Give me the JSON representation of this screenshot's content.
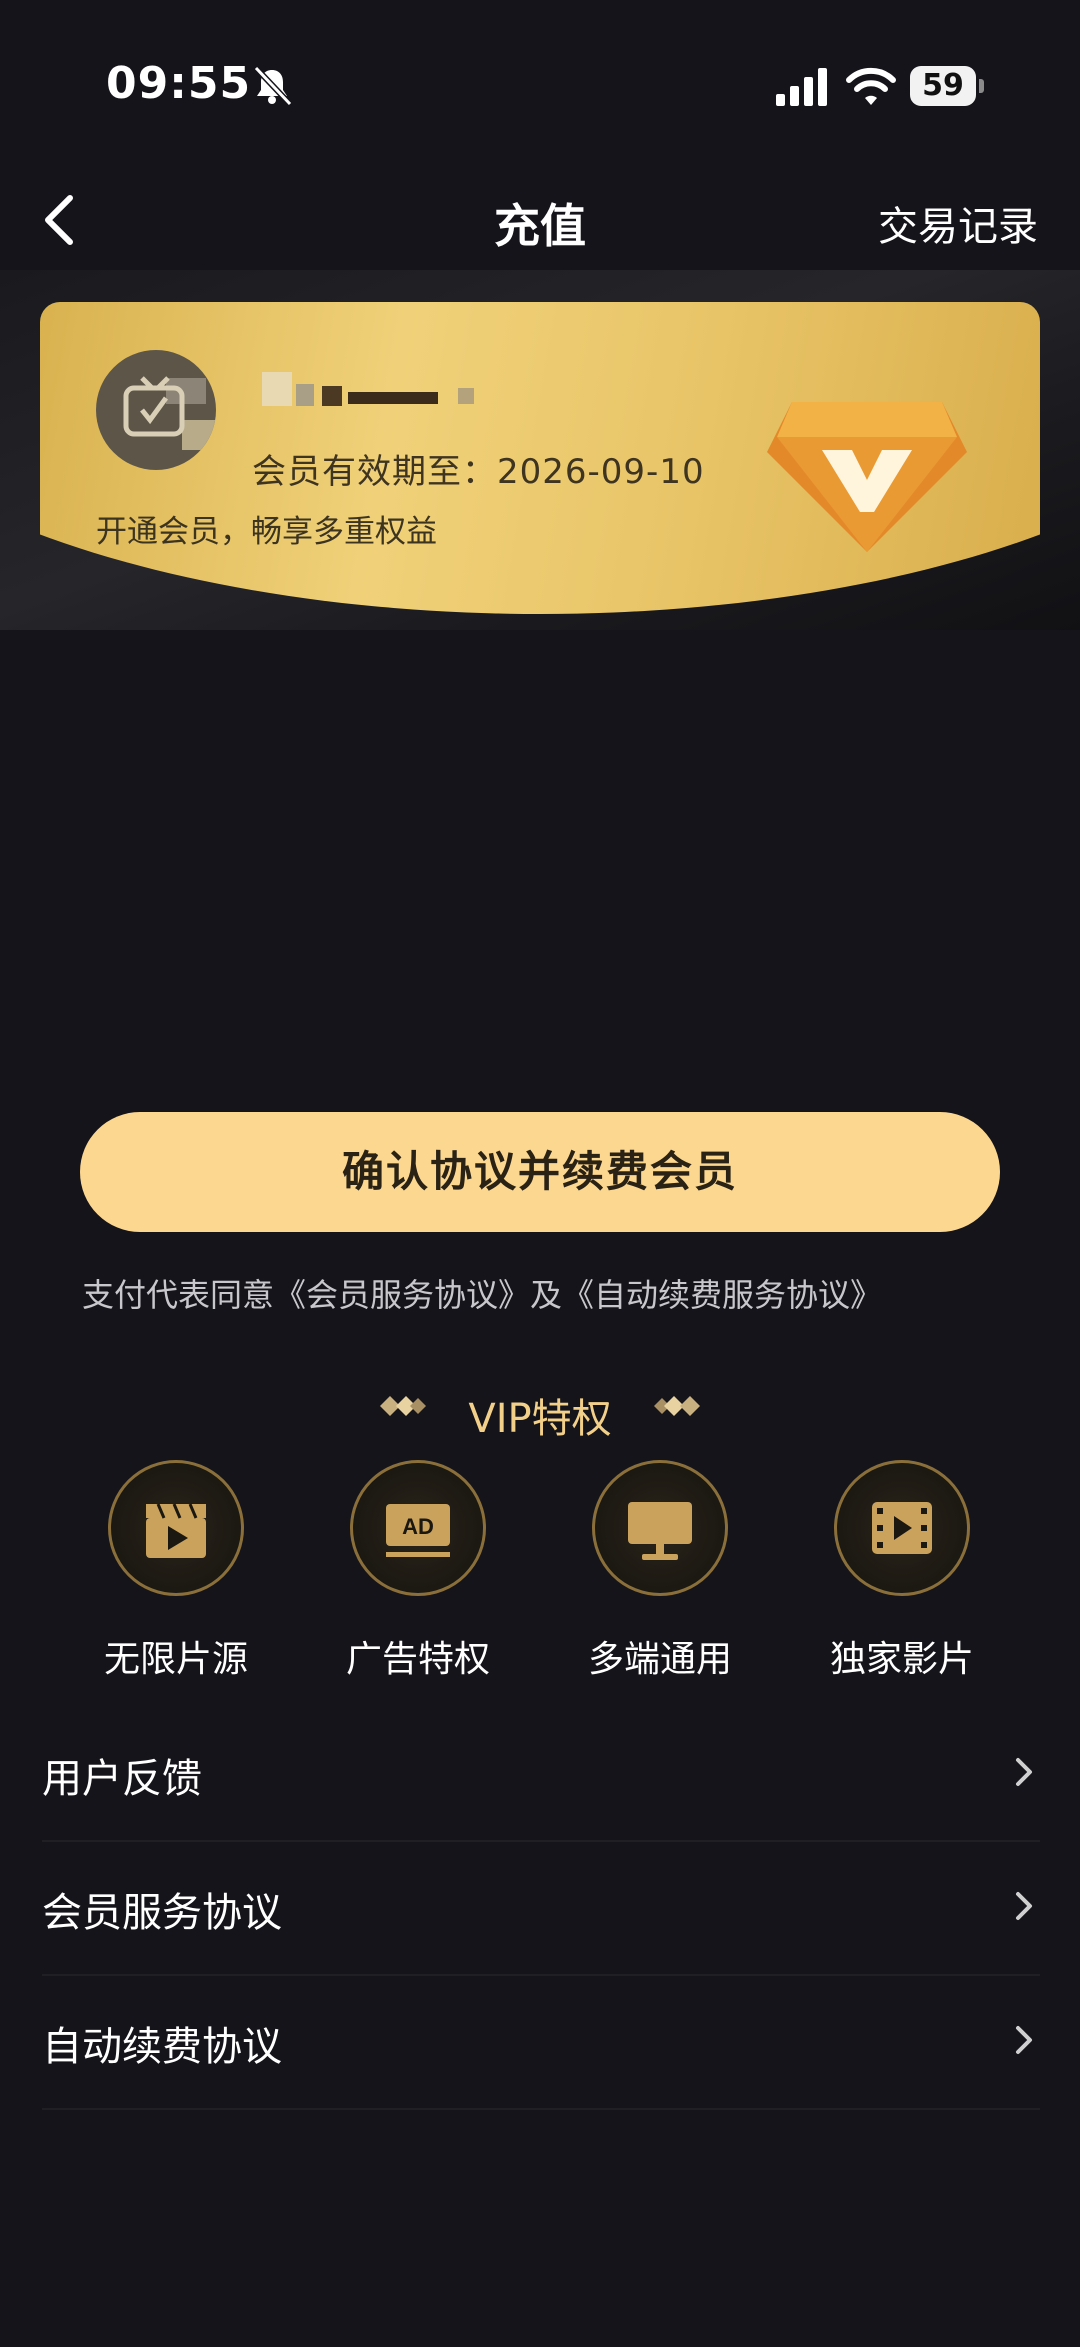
{
  "status_bar": {
    "time": "09:55",
    "battery": "59"
  },
  "nav": {
    "title": "充值",
    "right_link": "交易记录"
  },
  "member_card": {
    "expiry": "会员有效期至：2026-09-10",
    "slogan": "开通会员，畅享多重权益"
  },
  "confirm_button": "确认协议并续费会员",
  "agreement_text": "支付代表同意《会员服务协议》及《自动续费服务协议》",
  "vip": {
    "title": "VIP特权",
    "privileges": [
      {
        "label": "无限片源",
        "icon": "clapperboard-icon"
      },
      {
        "label": "广告特权",
        "icon": "ad-icon"
      },
      {
        "label": "多端通用",
        "icon": "monitor-icon"
      },
      {
        "label": "独家影片",
        "icon": "film-icon"
      }
    ]
  },
  "menu": [
    {
      "label": "用户反馈"
    },
    {
      "label": "会员服务协议"
    },
    {
      "label": "自动续费协议"
    }
  ],
  "colors": {
    "background": "#14141a",
    "gold": "#fcd78f",
    "card_gold": "#e8c467",
    "vip_text": "#f3d08a"
  }
}
